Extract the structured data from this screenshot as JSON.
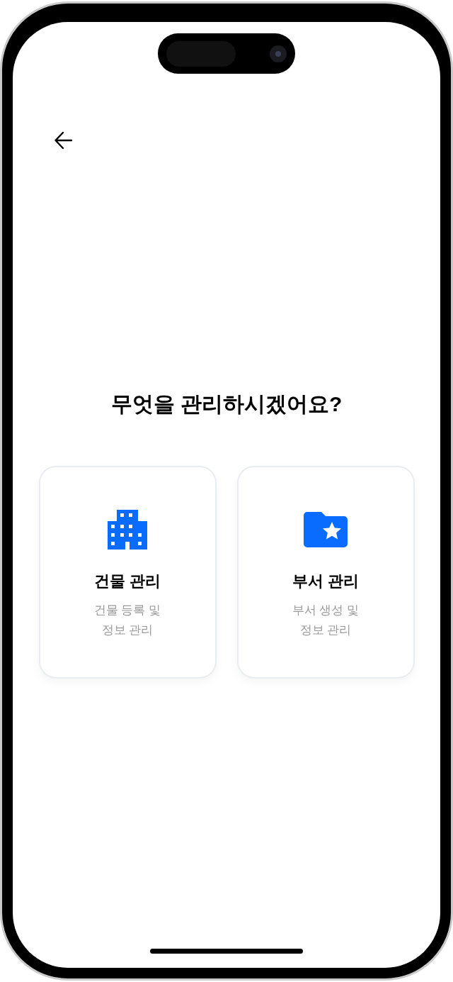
{
  "header": {
    "back": true
  },
  "title": "무엇을 관리하시겠어요?",
  "cards": [
    {
      "kind": "building",
      "title": "건물 관리",
      "description": "건물 등록 및\n정보 관리"
    },
    {
      "kind": "folder",
      "title": "부서 관리",
      "description": "부서 생성 및\n정보 관리"
    }
  ]
}
